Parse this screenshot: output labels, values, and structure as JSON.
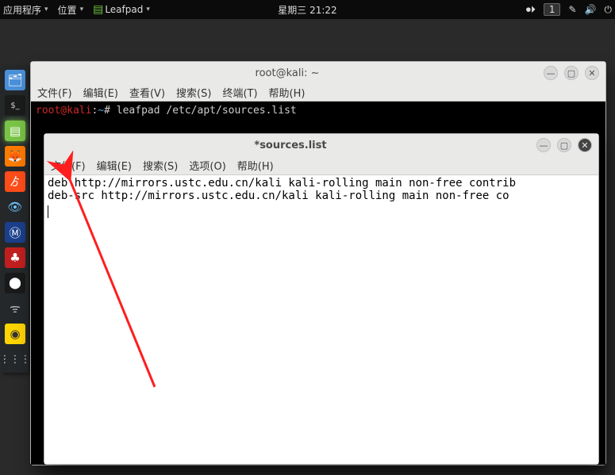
{
  "panel": {
    "apps_label": "应用程序",
    "places_label": "位置",
    "active_app": "Leafpad",
    "clock": "星期三 21:22",
    "workspace_badge": "1"
  },
  "dock": {
    "items": [
      {
        "name": "files"
      },
      {
        "name": "terminal"
      },
      {
        "name": "leafpad"
      },
      {
        "name": "firefox"
      },
      {
        "name": "burp"
      },
      {
        "name": "eye"
      },
      {
        "name": "metasploit"
      },
      {
        "name": "cherrytree"
      },
      {
        "name": "record"
      },
      {
        "name": "wifi"
      },
      {
        "name": "idea"
      },
      {
        "name": "apps-grid"
      }
    ]
  },
  "terminal": {
    "title": "root@kali: ~",
    "menu": [
      "文件(F)",
      "编辑(E)",
      "查看(V)",
      "搜索(S)",
      "终端(T)",
      "帮助(H)"
    ],
    "prompt_user": "root@kali",
    "prompt_sep": ":",
    "prompt_path": "~",
    "prompt_hash": "#",
    "command": "leafpad /etc/apt/sources.list",
    "btn_min": "—",
    "btn_max": "▢",
    "btn_close": "✕"
  },
  "leafpad": {
    "title": "*sources.list",
    "menu": [
      "文件(F)",
      "编辑(E)",
      "搜索(S)",
      "选项(O)",
      "帮助(H)"
    ],
    "lines": [
      "deb http://mirrors.ustc.edu.cn/kali kali-rolling main non-free contrib",
      "deb-src http://mirrors.ustc.edu.cn/kali kali-rolling main non-free co"
    ],
    "btn_min": "—",
    "btn_max": "▢",
    "btn_close": "✕"
  },
  "annotation": {
    "color": "#ff1e1e"
  }
}
